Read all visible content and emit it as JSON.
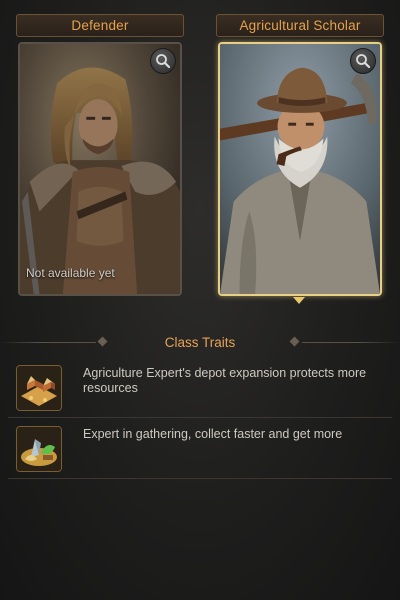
{
  "cards": [
    {
      "title": "Defender",
      "status_text": "Not available yet",
      "selected": false,
      "zoom_icon": "magnifier-icon"
    },
    {
      "title": "Agricultural Scholar",
      "status_text": "",
      "selected": true,
      "zoom_icon": "magnifier-icon"
    }
  ],
  "traits_section": {
    "title": "Class Traits",
    "items": [
      {
        "icon": "depot-buildings-icon",
        "text": "Agriculture Expert's depot expansion protects more resources"
      },
      {
        "icon": "gathering-resources-icon",
        "text": "Expert in gathering, collect faster and get more"
      }
    ]
  },
  "colors": {
    "accent_orange": "#e6a24c",
    "selected_border": "#e8cf86",
    "background": "#1e1e1d"
  }
}
